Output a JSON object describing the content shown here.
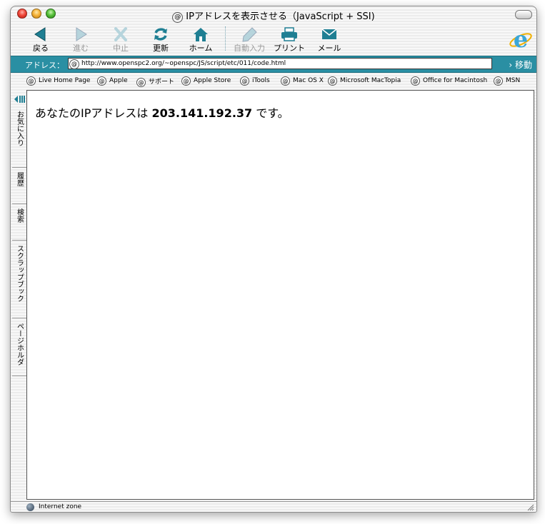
{
  "window": {
    "title": "IPアドレスを表示させる（JavaScript + SSI)"
  },
  "toolbar": {
    "buttons": [
      {
        "label": "戻る",
        "icon": "back-arrow-icon",
        "enabled": true
      },
      {
        "label": "進む",
        "icon": "forward-arrow-icon",
        "enabled": false
      },
      {
        "label": "中止",
        "icon": "stop-x-icon",
        "enabled": false
      },
      {
        "label": "更新",
        "icon": "refresh-icon",
        "enabled": true
      },
      {
        "label": "ホーム",
        "icon": "home-icon",
        "enabled": true
      },
      {
        "label": "自動入力",
        "icon": "autofill-pen-icon",
        "enabled": false
      },
      {
        "label": "プリント",
        "icon": "printer-icon",
        "enabled": true
      },
      {
        "label": "メール",
        "icon": "mail-icon",
        "enabled": true
      }
    ]
  },
  "address_bar": {
    "label": "アドレス：",
    "url": "http://www.openspc2.org/~openspc/JS/script/etc/011/code.html",
    "go_label": "移動"
  },
  "favorites": [
    "Live Home Page",
    "Apple",
    "サポート",
    "Apple Store",
    "iTools",
    "Mac OS X",
    "Microsoft MacTopia",
    "Office for Macintosh",
    "MSN"
  ],
  "explorer_tabs": [
    "お気に入り",
    "履歴",
    "検索",
    "スクラップブック",
    "ページホルダ"
  ],
  "content": {
    "prefix": "あなたのIPアドレスは",
    "ip": "203.141.192.37",
    "suffix": "です。"
  },
  "status": {
    "zone": "Internet zone"
  },
  "colors": {
    "accent_teal": "#2a8fa3",
    "icon_teal": "#1f7f93"
  }
}
